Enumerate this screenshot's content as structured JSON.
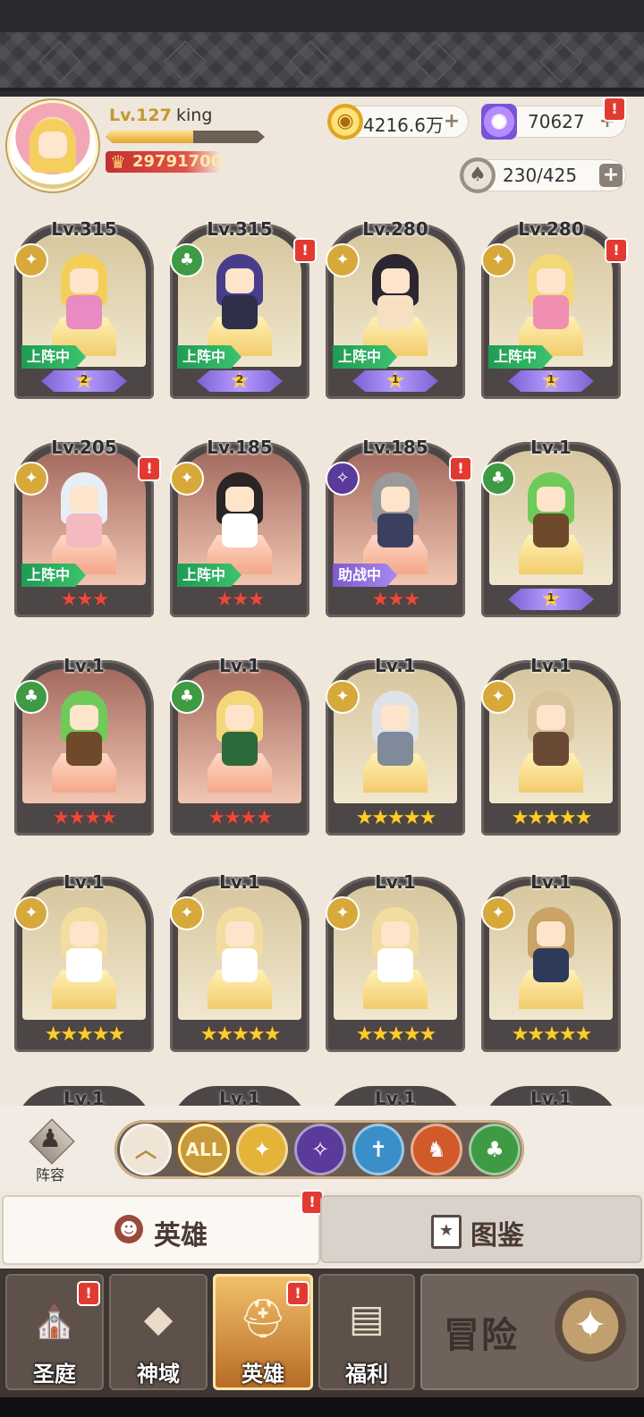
{
  "player": {
    "level": "Lv.127",
    "name": "king",
    "xp_fraction": 0.55,
    "power": "29791700"
  },
  "resources": {
    "gold": "4216.6万",
    "gems": "70627",
    "stamina": "230/425",
    "plus": "+",
    "badge": "!"
  },
  "heroes": [
    {
      "level": "Lv.315",
      "faction": "light",
      "status": "上阵中",
      "rank": "2",
      "rarity": "legendary",
      "hair": "#f4cf58",
      "body": "#e98ac2",
      "badge": false
    },
    {
      "level": "Lv.315",
      "faction": "nature",
      "status": "上阵中",
      "rank": "2",
      "rarity": "legendary",
      "hair": "#4a3c8c",
      "body": "#2f2f49",
      "badge": true
    },
    {
      "level": "Lv.280",
      "faction": "light",
      "status": "上阵中",
      "rank": "1",
      "rarity": "legendary",
      "hair": "#2b2630",
      "body": "#f7e0c2",
      "badge": false
    },
    {
      "level": "Lv.280",
      "faction": "light",
      "status": "上阵中",
      "rank": "1",
      "rarity": "legendary",
      "hair": "#f3d879",
      "body": "#f08fb0",
      "badge": true
    },
    {
      "level": "Lv.205",
      "faction": "light",
      "status": "上阵中",
      "stars": "★★★",
      "rarity": "epic",
      "hair": "#e8eef5",
      "body": "#f5b9c0",
      "badge": true
    },
    {
      "level": "Lv.185",
      "faction": "light",
      "status": "上阵中",
      "stars": "★★★",
      "rarity": "epic",
      "hair": "#2a2525",
      "body": "#ffffff",
      "badge": false
    },
    {
      "level": "Lv.185",
      "faction": "dark",
      "status": "助战中",
      "stars": "★★★",
      "rarity": "epic",
      "hair": "#9a9a9a",
      "body": "#3c4060",
      "badge": true
    },
    {
      "level": "Lv.1",
      "faction": "nature",
      "status": "",
      "rank": "1",
      "rarity": "legendary",
      "hair": "#6ecb5a",
      "body": "#6e4a2a",
      "badge": false
    },
    {
      "level": "Lv.1",
      "faction": "nature",
      "status": "",
      "stars": "★★★★",
      "rarity": "epic",
      "hair": "#6ecb5a",
      "body": "#6e4a2a",
      "badge": false
    },
    {
      "level": "Lv.1",
      "faction": "nature",
      "status": "",
      "stars": "★★★★",
      "rarity": "epic",
      "hair": "#f3d879",
      "body": "#2d6a3b",
      "badge": false
    },
    {
      "level": "Lv.1",
      "faction": "light",
      "status": "",
      "stars": "★★★★★",
      "rarity": "legendary",
      "hair": "#dfe3e8",
      "body": "#7f8a9a",
      "badge": false
    },
    {
      "level": "Lv.1",
      "faction": "light",
      "status": "",
      "stars": "★★★★★",
      "rarity": "legendary",
      "hair": "#d9c49a",
      "body": "#6a4a35",
      "badge": false
    },
    {
      "level": "Lv.1",
      "faction": "light",
      "status": "",
      "stars": "★★★★★",
      "rarity": "legendary",
      "hair": "#f3dca0",
      "body": "#ffffff",
      "badge": false
    },
    {
      "level": "Lv.1",
      "faction": "light",
      "status": "",
      "stars": "★★★★★",
      "rarity": "legendary",
      "hair": "#f3dca0",
      "body": "#ffffff",
      "badge": false
    },
    {
      "level": "Lv.1",
      "faction": "light",
      "status": "",
      "stars": "★★★★★",
      "rarity": "legendary",
      "hair": "#f3dca0",
      "body": "#ffffff",
      "badge": false
    },
    {
      "level": "Lv.1",
      "faction": "light",
      "status": "",
      "stars": "★★★★★",
      "rarity": "legendary",
      "hair": "#c9a465",
      "body": "#2e3a5a",
      "badge": false
    }
  ],
  "partial_row": [
    "Lv.1",
    "Lv.1",
    "Lv.1",
    "Lv.1"
  ],
  "faction_colors": {
    "light": "#d7a93a",
    "nature": "#3f9a44",
    "dark": "#5a3a9a"
  },
  "filters": {
    "lineup_label": "阵容",
    "items": [
      {
        "name": "collapse",
        "glyph": "︿",
        "color": "#efe5d6",
        "text_color": "#b78a3e"
      },
      {
        "name": "all",
        "glyph": "ALL",
        "color": "#c99a3a",
        "text_color": "#fff7d8"
      },
      {
        "name": "light",
        "glyph": "✦",
        "color": "#e3b33a",
        "text_color": "#fff"
      },
      {
        "name": "dark",
        "glyph": "✧",
        "color": "#5a3a9a",
        "text_color": "#fff"
      },
      {
        "name": "holy",
        "glyph": "✝",
        "color": "#3a8fc9",
        "text_color": "#fff"
      },
      {
        "name": "beast",
        "glyph": "♞",
        "color": "#d05a2a",
        "text_color": "#fff"
      },
      {
        "name": "nature",
        "glyph": "♣",
        "color": "#3f9a44",
        "text_color": "#fff"
      }
    ]
  },
  "tabs": {
    "heroes": "英雄",
    "codex": "图鉴"
  },
  "nav": {
    "items": [
      {
        "label": "圣庭",
        "glyph": "⛪",
        "badge": true,
        "active": false
      },
      {
        "label": "神域",
        "glyph": "◆",
        "badge": false,
        "active": false
      },
      {
        "label": "英雄",
        "glyph": "⛑",
        "badge": true,
        "active": true
      },
      {
        "label": "福利",
        "glyph": "▤",
        "badge": false,
        "active": false
      }
    ],
    "adventure": "冒险",
    "adventure_glyph": "✦"
  }
}
